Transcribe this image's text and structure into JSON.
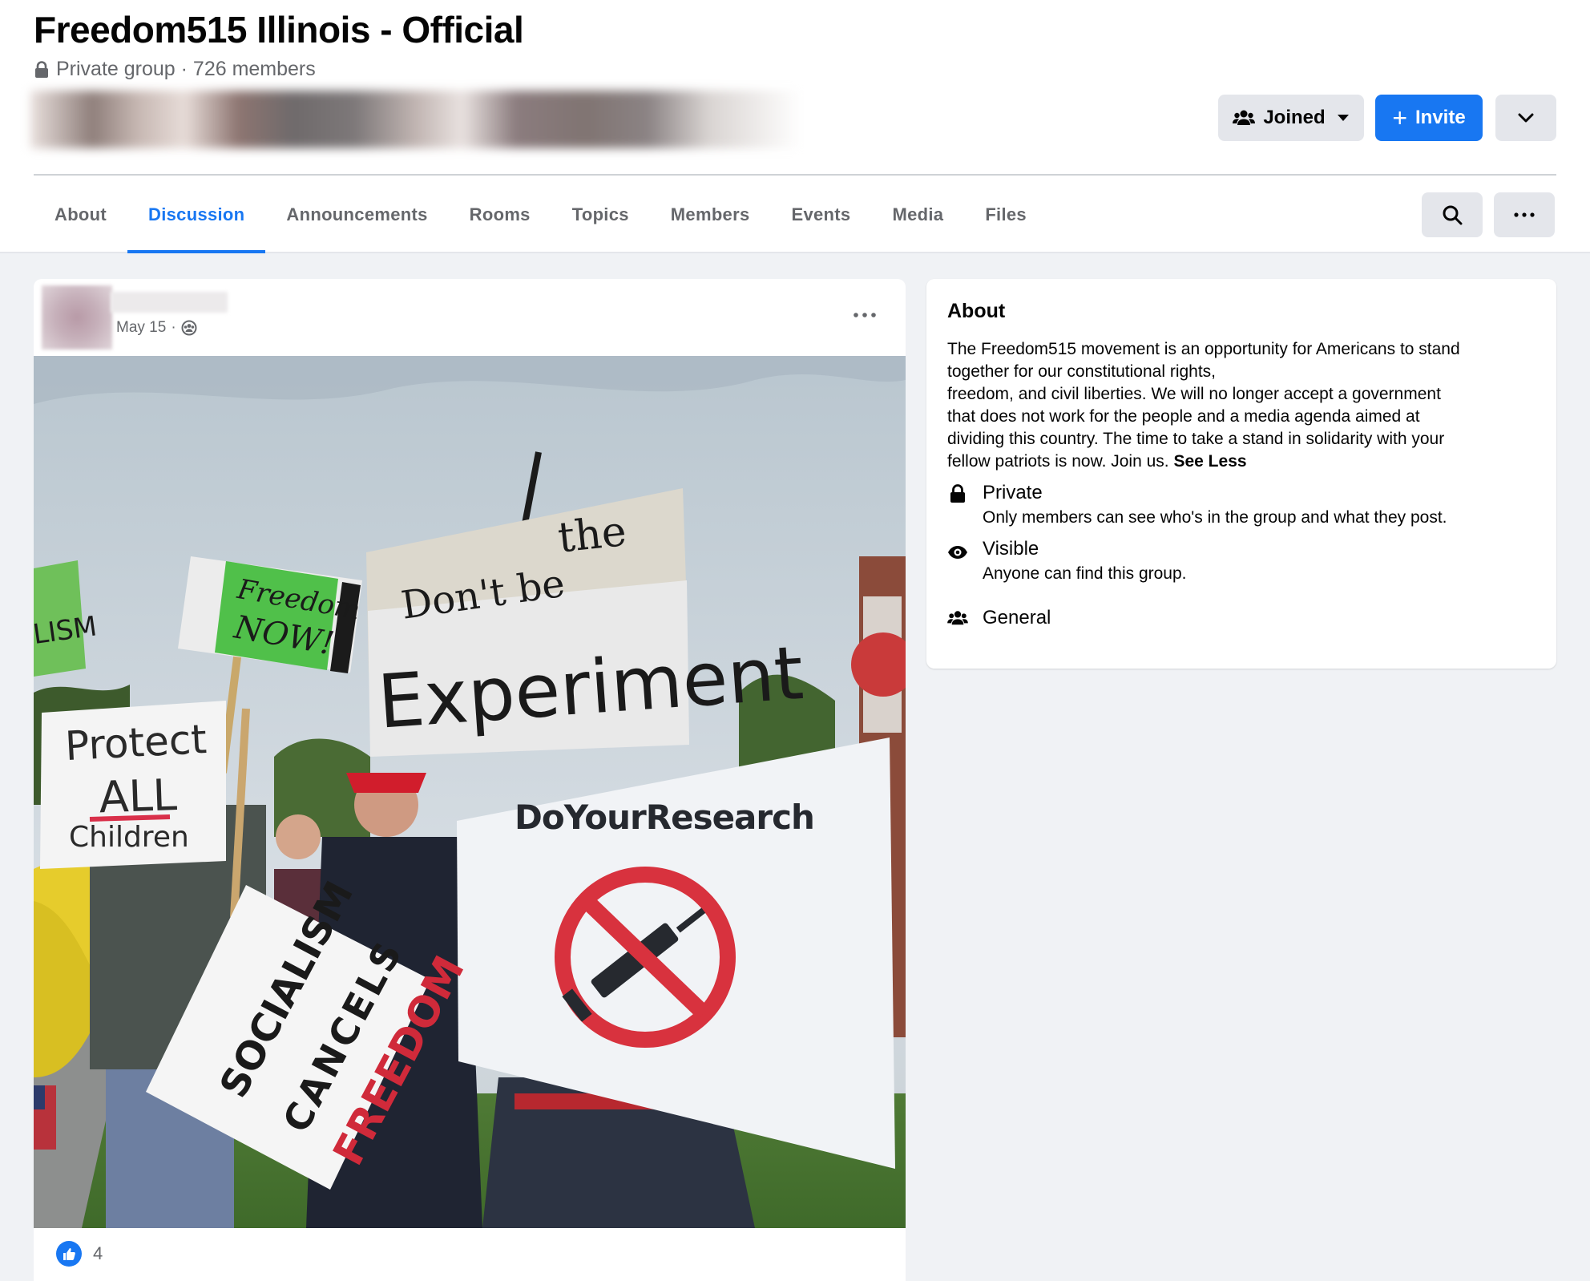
{
  "group": {
    "title": "Freedom515 Illinois - Official",
    "meta": "Private group · 726 members",
    "icons": {
      "privacy": "lock-icon"
    }
  },
  "header_actions": {
    "joined_label": "Joined",
    "invite_label": "Invite",
    "icons": [
      "members-icon",
      "caret-down-icon",
      "plus-icon",
      "chevron-down-icon"
    ]
  },
  "tabs": [
    {
      "label": "About",
      "active": false
    },
    {
      "label": "Discussion",
      "active": true
    },
    {
      "label": "Announcements",
      "active": false
    },
    {
      "label": "Rooms",
      "active": false
    },
    {
      "label": "Topics",
      "active": false
    },
    {
      "label": "Members",
      "active": false
    },
    {
      "label": "Events",
      "active": false
    },
    {
      "label": "Media",
      "active": false
    },
    {
      "label": "Files",
      "active": false
    }
  ],
  "post": {
    "date": "May 15",
    "separator": "·",
    "audience_icon": "group-audience-icon",
    "photo_signs": {
      "freedom_now_1": "Freedom",
      "freedom_now_2": "NOW!",
      "ism": "LISM",
      "dont_be": "Don't be",
      "the": "the",
      "experiment": "Experiment",
      "protect": "Protect",
      "all": "ALL",
      "children": "Children",
      "do_your_research": "DoYourResearch",
      "socialism": "SOCIALISM",
      "cancels": "CANCELS",
      "freedom": "FREEDOM"
    },
    "reaction_count": "4"
  },
  "about": {
    "title": "About",
    "description_lines": [
      "The Freedom515 movement is an opportunity for Americans to stand",
      "together for our constitutional rights,",
      "freedom, and civil liberties. We will no longer accept a government",
      "that does not work for the people and a media agenda aimed at",
      "dividing this country. The time to take a stand in solidarity with your",
      "fellow patriots is now. Join us."
    ],
    "see_less": "See Less",
    "private_label": "Private",
    "private_sub": "Only members can see who's in the group and what they post.",
    "visible_label": "Visible",
    "visible_sub": "Anyone can find this group.",
    "general_label": "General"
  },
  "colors": {
    "accent": "#1877f2",
    "page_bg": "#f0f2f5",
    "secondary_text": "#65676b",
    "button_grey": "#e4e6eb"
  }
}
